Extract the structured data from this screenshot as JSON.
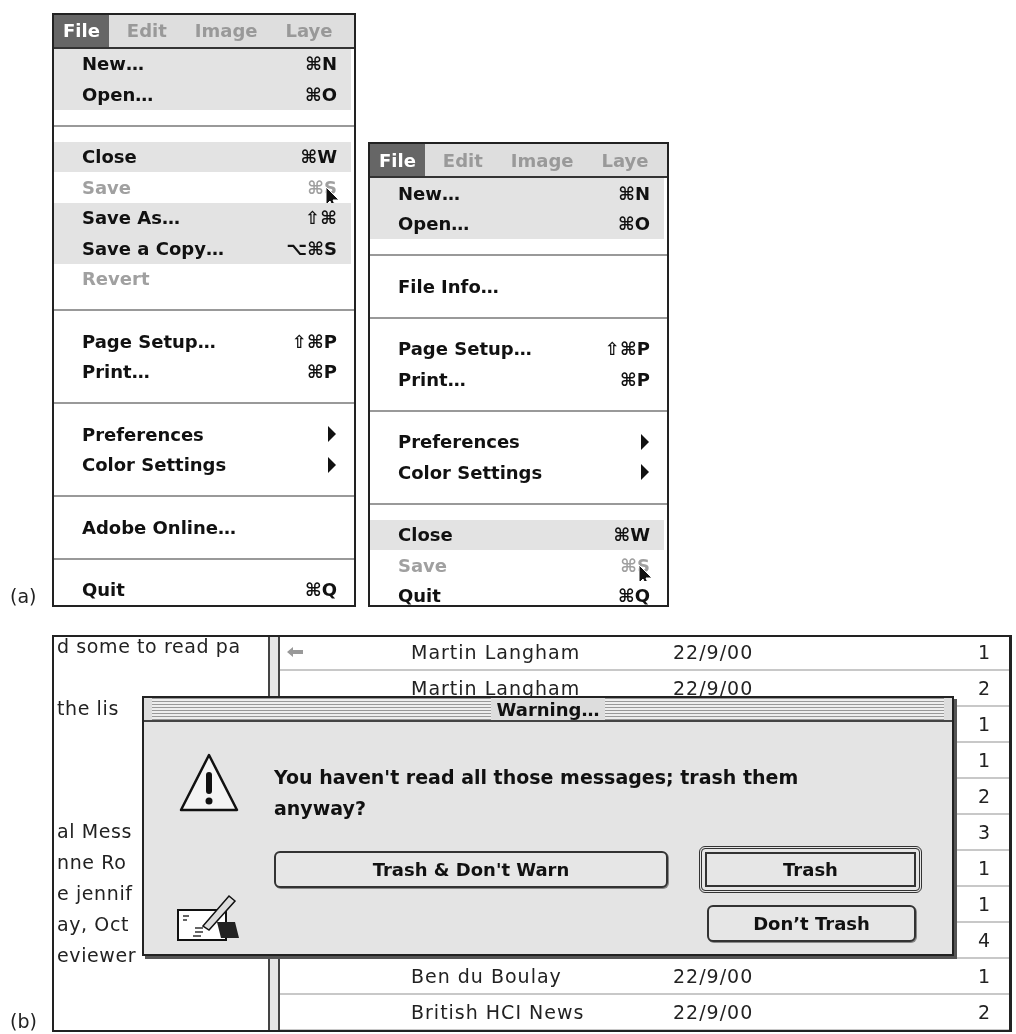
{
  "figure_a": {
    "label": "(a)",
    "menus": [
      {
        "menubar": [
          {
            "label": "File",
            "selected": true
          },
          {
            "label": "Edit",
            "selected": false
          },
          {
            "label": "Image",
            "selected": false
          },
          {
            "label": "Laye",
            "selected": false
          }
        ],
        "items": [
          {
            "kind": "item",
            "label": "New…",
            "shortcut": "⌘N",
            "highlighted": true,
            "disabled": false
          },
          {
            "kind": "item",
            "label": "Open…",
            "shortcut": "⌘O",
            "highlighted": true,
            "disabled": false
          },
          {
            "kind": "separator"
          },
          {
            "kind": "item",
            "label": "Close",
            "shortcut": "⌘W",
            "highlighted": true,
            "disabled": false
          },
          {
            "kind": "item",
            "label": "Save",
            "shortcut": "⌘S",
            "highlighted": false,
            "disabled": true,
            "pointer": true
          },
          {
            "kind": "item",
            "label": "Save As…",
            "shortcut": "⇧⌘",
            "highlighted": true,
            "disabled": false
          },
          {
            "kind": "item",
            "label": "Save a Copy…",
            "shortcut": "⌥⌘S",
            "highlighted": true,
            "disabled": false
          },
          {
            "kind": "item",
            "label": "Revert",
            "highlighted": false,
            "disabled": true
          },
          {
            "kind": "separator"
          },
          {
            "kind": "item",
            "label": "Page Setup…",
            "shortcut": "⇧⌘P",
            "highlighted": false,
            "disabled": false
          },
          {
            "kind": "item",
            "label": "Print…",
            "shortcut": "⌘P",
            "highlighted": false,
            "disabled": false
          },
          {
            "kind": "separator"
          },
          {
            "kind": "item",
            "label": "Preferences",
            "submenu": true,
            "highlighted": false,
            "disabled": false
          },
          {
            "kind": "item",
            "label": "Color Settings",
            "submenu": true,
            "highlighted": false,
            "disabled": false
          },
          {
            "kind": "separator"
          },
          {
            "kind": "item",
            "label": "Adobe Online…",
            "highlighted": false,
            "disabled": false
          },
          {
            "kind": "separator"
          },
          {
            "kind": "item",
            "label": "Quit",
            "shortcut": "⌘Q",
            "highlighted": false,
            "disabled": false
          }
        ]
      },
      {
        "menubar": [
          {
            "label": "File",
            "selected": true
          },
          {
            "label": "Edit",
            "selected": false
          },
          {
            "label": "Image",
            "selected": false
          },
          {
            "label": "Laye",
            "selected": false
          }
        ],
        "items": [
          {
            "kind": "item",
            "label": "New…",
            "shortcut": "⌘N",
            "highlighted": true,
            "disabled": false
          },
          {
            "kind": "item",
            "label": "Open…",
            "shortcut": "⌘O",
            "highlighted": true,
            "disabled": false
          },
          {
            "kind": "separator"
          },
          {
            "kind": "item",
            "label": "File Info…",
            "highlighted": false,
            "disabled": false
          },
          {
            "kind": "separator"
          },
          {
            "kind": "item",
            "label": "Page Setup…",
            "shortcut": "⇧⌘P",
            "highlighted": false,
            "disabled": false
          },
          {
            "kind": "item",
            "label": "Print…",
            "shortcut": "⌘P",
            "highlighted": false,
            "disabled": false
          },
          {
            "kind": "separator"
          },
          {
            "kind": "item",
            "label": "Preferences",
            "submenu": true,
            "highlighted": false,
            "disabled": false
          },
          {
            "kind": "item",
            "label": "Color Settings",
            "submenu": true,
            "highlighted": false,
            "disabled": false
          },
          {
            "kind": "separator"
          },
          {
            "kind": "item",
            "label": "Close",
            "shortcut": "⌘W",
            "highlighted": true,
            "disabled": false
          },
          {
            "kind": "item",
            "label": "Save",
            "shortcut": "⌘S",
            "highlighted": false,
            "disabled": true,
            "pointer": true
          },
          {
            "kind": "item",
            "label": "Quit",
            "shortcut": "⌘Q",
            "highlighted": false,
            "disabled": false
          }
        ]
      }
    ]
  },
  "figure_b": {
    "label": "(b)",
    "left_pane": {
      "top_lines": [
        "d some to read pa",
        "the lis"
      ],
      "bottom_lines": [
        "al Mess",
        "nne Ro",
        "e jennif",
        "ay, Oct",
        "eviewer"
      ]
    },
    "message_list": {
      "rows": [
        {
          "name": "Martin Langham",
          "date": "22/9/00",
          "count": "1",
          "arrow": true
        },
        {
          "name": "Martin Langham",
          "date": "22/9/00",
          "count": "2"
        },
        {
          "count": "1"
        },
        {
          "count": "1"
        },
        {
          "count": "2"
        },
        {
          "count": "3"
        },
        {
          "count": "1"
        },
        {
          "count": "1"
        },
        {
          "count": "4"
        },
        {
          "name": "Ben du Boulay",
          "date": "22/9/00",
          "count": "1"
        },
        {
          "name": "British HCI News",
          "date": "22/9/00",
          "count": "2"
        }
      ]
    },
    "dialog": {
      "title": "Warning…",
      "message": "You haven't read all those messages; trash them anyway?",
      "buttons": [
        {
          "label": "Trash & Don't Warn",
          "default": false
        },
        {
          "label": "Trash",
          "default": true
        },
        {
          "label": "Don’t Trash",
          "default": false
        }
      ]
    }
  }
}
